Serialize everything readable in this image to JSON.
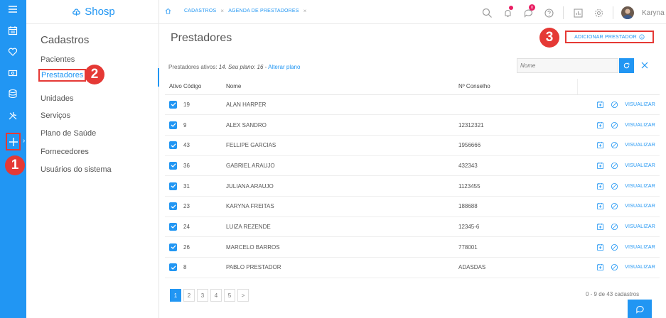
{
  "brand": {
    "name": "Shosp"
  },
  "rail": {
    "icons": [
      "menu-icon",
      "calendar-icon",
      "heart-icon",
      "money-icon",
      "database-icon",
      "tools-icon",
      "plus-icon"
    ],
    "arrow": "›"
  },
  "badges": {
    "one": "1",
    "two": "2",
    "three": "3"
  },
  "subnav": {
    "title": "Cadastros",
    "items": [
      {
        "label": "Pacientes"
      },
      {
        "label": "Prestadores"
      },
      {
        "label": "Unidades"
      },
      {
        "label": "Serviços"
      },
      {
        "label": "Plano de Saúde"
      },
      {
        "label": "Fornecedores"
      },
      {
        "label": "Usuários do sistema"
      }
    ]
  },
  "topbar": {
    "breadcrumb": [
      {
        "label": "CADASTROS",
        "close": "×"
      },
      {
        "label": "AGENDA DE PRESTADORES",
        "close": "×"
      }
    ],
    "notification_badge": "0",
    "user_name": "Karyna",
    "user_chevron": "⌄"
  },
  "main": {
    "title": "Prestadores",
    "add_button": "ADICIONAR PRESTADOR",
    "plan": {
      "prefix": "Prestadores ativos: ",
      "italic": "14. Seu plano: 16",
      "separator": " - ",
      "link": "Alterar plano"
    },
    "search": {
      "placeholder": "Nome"
    },
    "table": {
      "headers": {
        "active": "Ativo",
        "code": "Código",
        "name": "Nome",
        "council": "Nº Conselho"
      },
      "rows": [
        {
          "code": "19",
          "name": "ALAN HARPER",
          "council": ""
        },
        {
          "code": "9",
          "name": "ALEX SANDRO",
          "council": "12312321"
        },
        {
          "code": "43",
          "name": "FELLIPE GARCIAS",
          "council": "1956666"
        },
        {
          "code": "36",
          "name": "GABRIEL ARAUJO",
          "council": "432343"
        },
        {
          "code": "31",
          "name": "JULIANA ARAUJO",
          "council": "1123455"
        },
        {
          "code": "23",
          "name": "KARYNA FREITAS",
          "council": "188688"
        },
        {
          "code": "24",
          "name": "LUIZA REZENDE",
          "council": "12345-6"
        },
        {
          "code": "26",
          "name": "MARCELO BARROS",
          "council": "778001"
        },
        {
          "code": "8",
          "name": "PABLO PRESTADOR",
          "council": "ADASDAS"
        }
      ],
      "row_action": "VISUALIZAR"
    },
    "pager": {
      "pages": [
        "1",
        "2",
        "3",
        "4",
        "5",
        ">"
      ],
      "current": "1",
      "info": "0 - 9 de 43 cadastros"
    }
  },
  "colors": {
    "primary": "#2196f3",
    "highlight": "#e53935",
    "notification": "#e91e63"
  }
}
